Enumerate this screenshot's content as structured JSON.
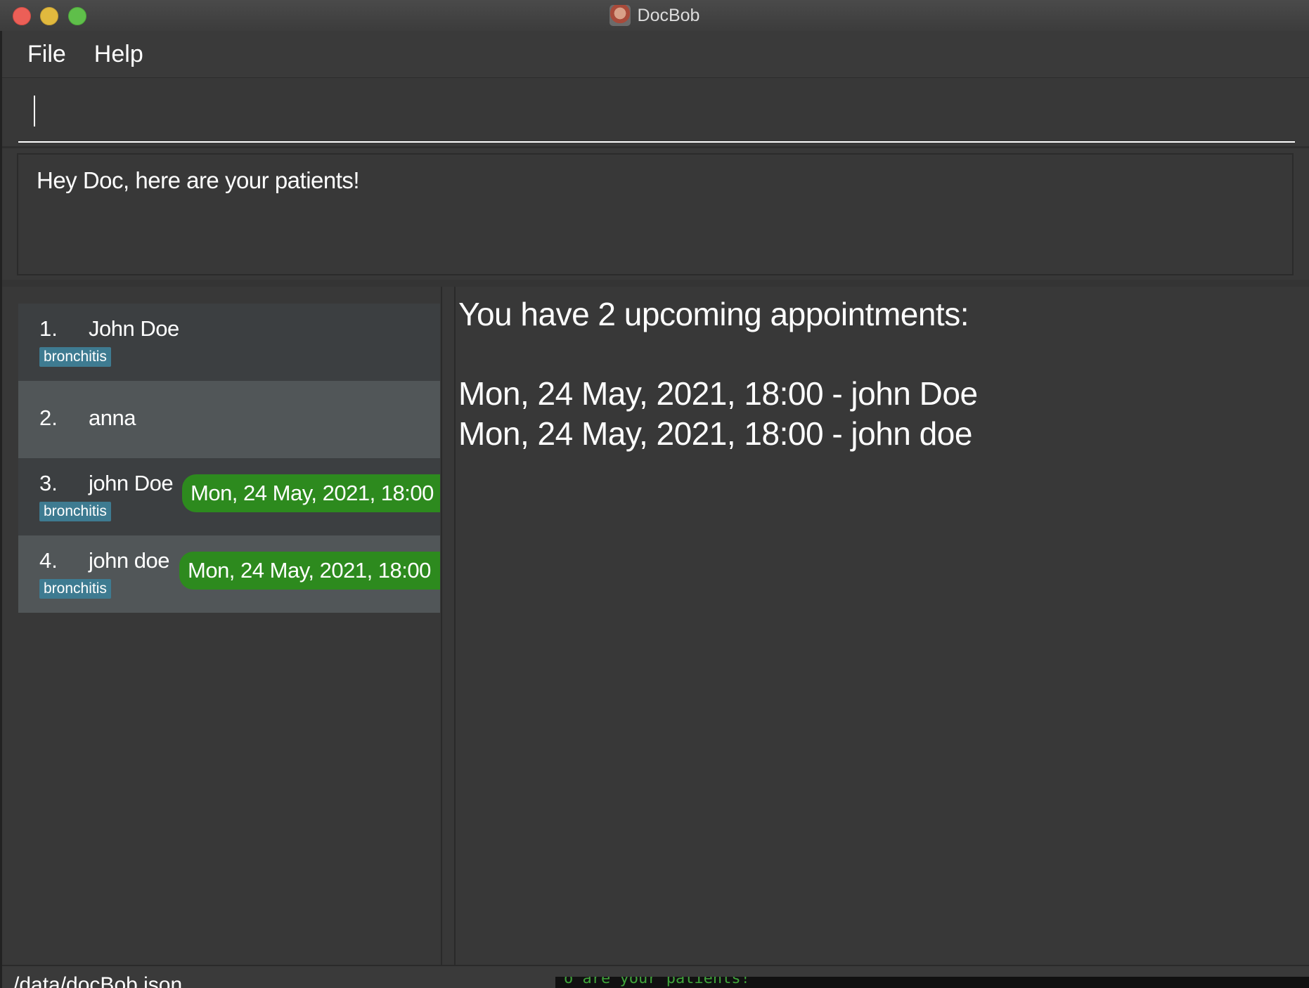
{
  "window": {
    "title": "DocBob",
    "app_icon": "docbob-app-icon"
  },
  "menu": {
    "items": [
      {
        "label": "File"
      },
      {
        "label": "Help"
      }
    ]
  },
  "command": {
    "value": "",
    "placeholder": ""
  },
  "result": {
    "message": "Hey Doc, here are your patients!"
  },
  "patients": [
    {
      "index": "1.",
      "name": "John Doe",
      "tags": [
        "bronchitis"
      ],
      "appointment": ""
    },
    {
      "index": "2.",
      "name": "anna",
      "tags": [],
      "appointment": ""
    },
    {
      "index": "3.",
      "name": "john Doe",
      "tags": [
        "bronchitis"
      ],
      "appointment": "Mon, 24 May, 2021, 18:00"
    },
    {
      "index": "4.",
      "name": "john doe",
      "tags": [
        "bronchitis"
      ],
      "appointment": "Mon, 24 May, 2021, 18:00"
    }
  ],
  "appointments": {
    "heading": "You have 2 upcoming appointments:",
    "lines": [
      "Mon, 24 May, 2021, 18:00 - john Doe",
      "Mon, 24 May, 2021, 18:00 - john doe"
    ]
  },
  "status": {
    "file_path": "/data/docBob.json"
  },
  "background_terminal": {
    "text": "o are your patients!"
  },
  "colors": {
    "tag": "#3e7b91",
    "appointment_badge": "#2d8a1e",
    "panel": "#383838",
    "card_alt": "#515658"
  }
}
